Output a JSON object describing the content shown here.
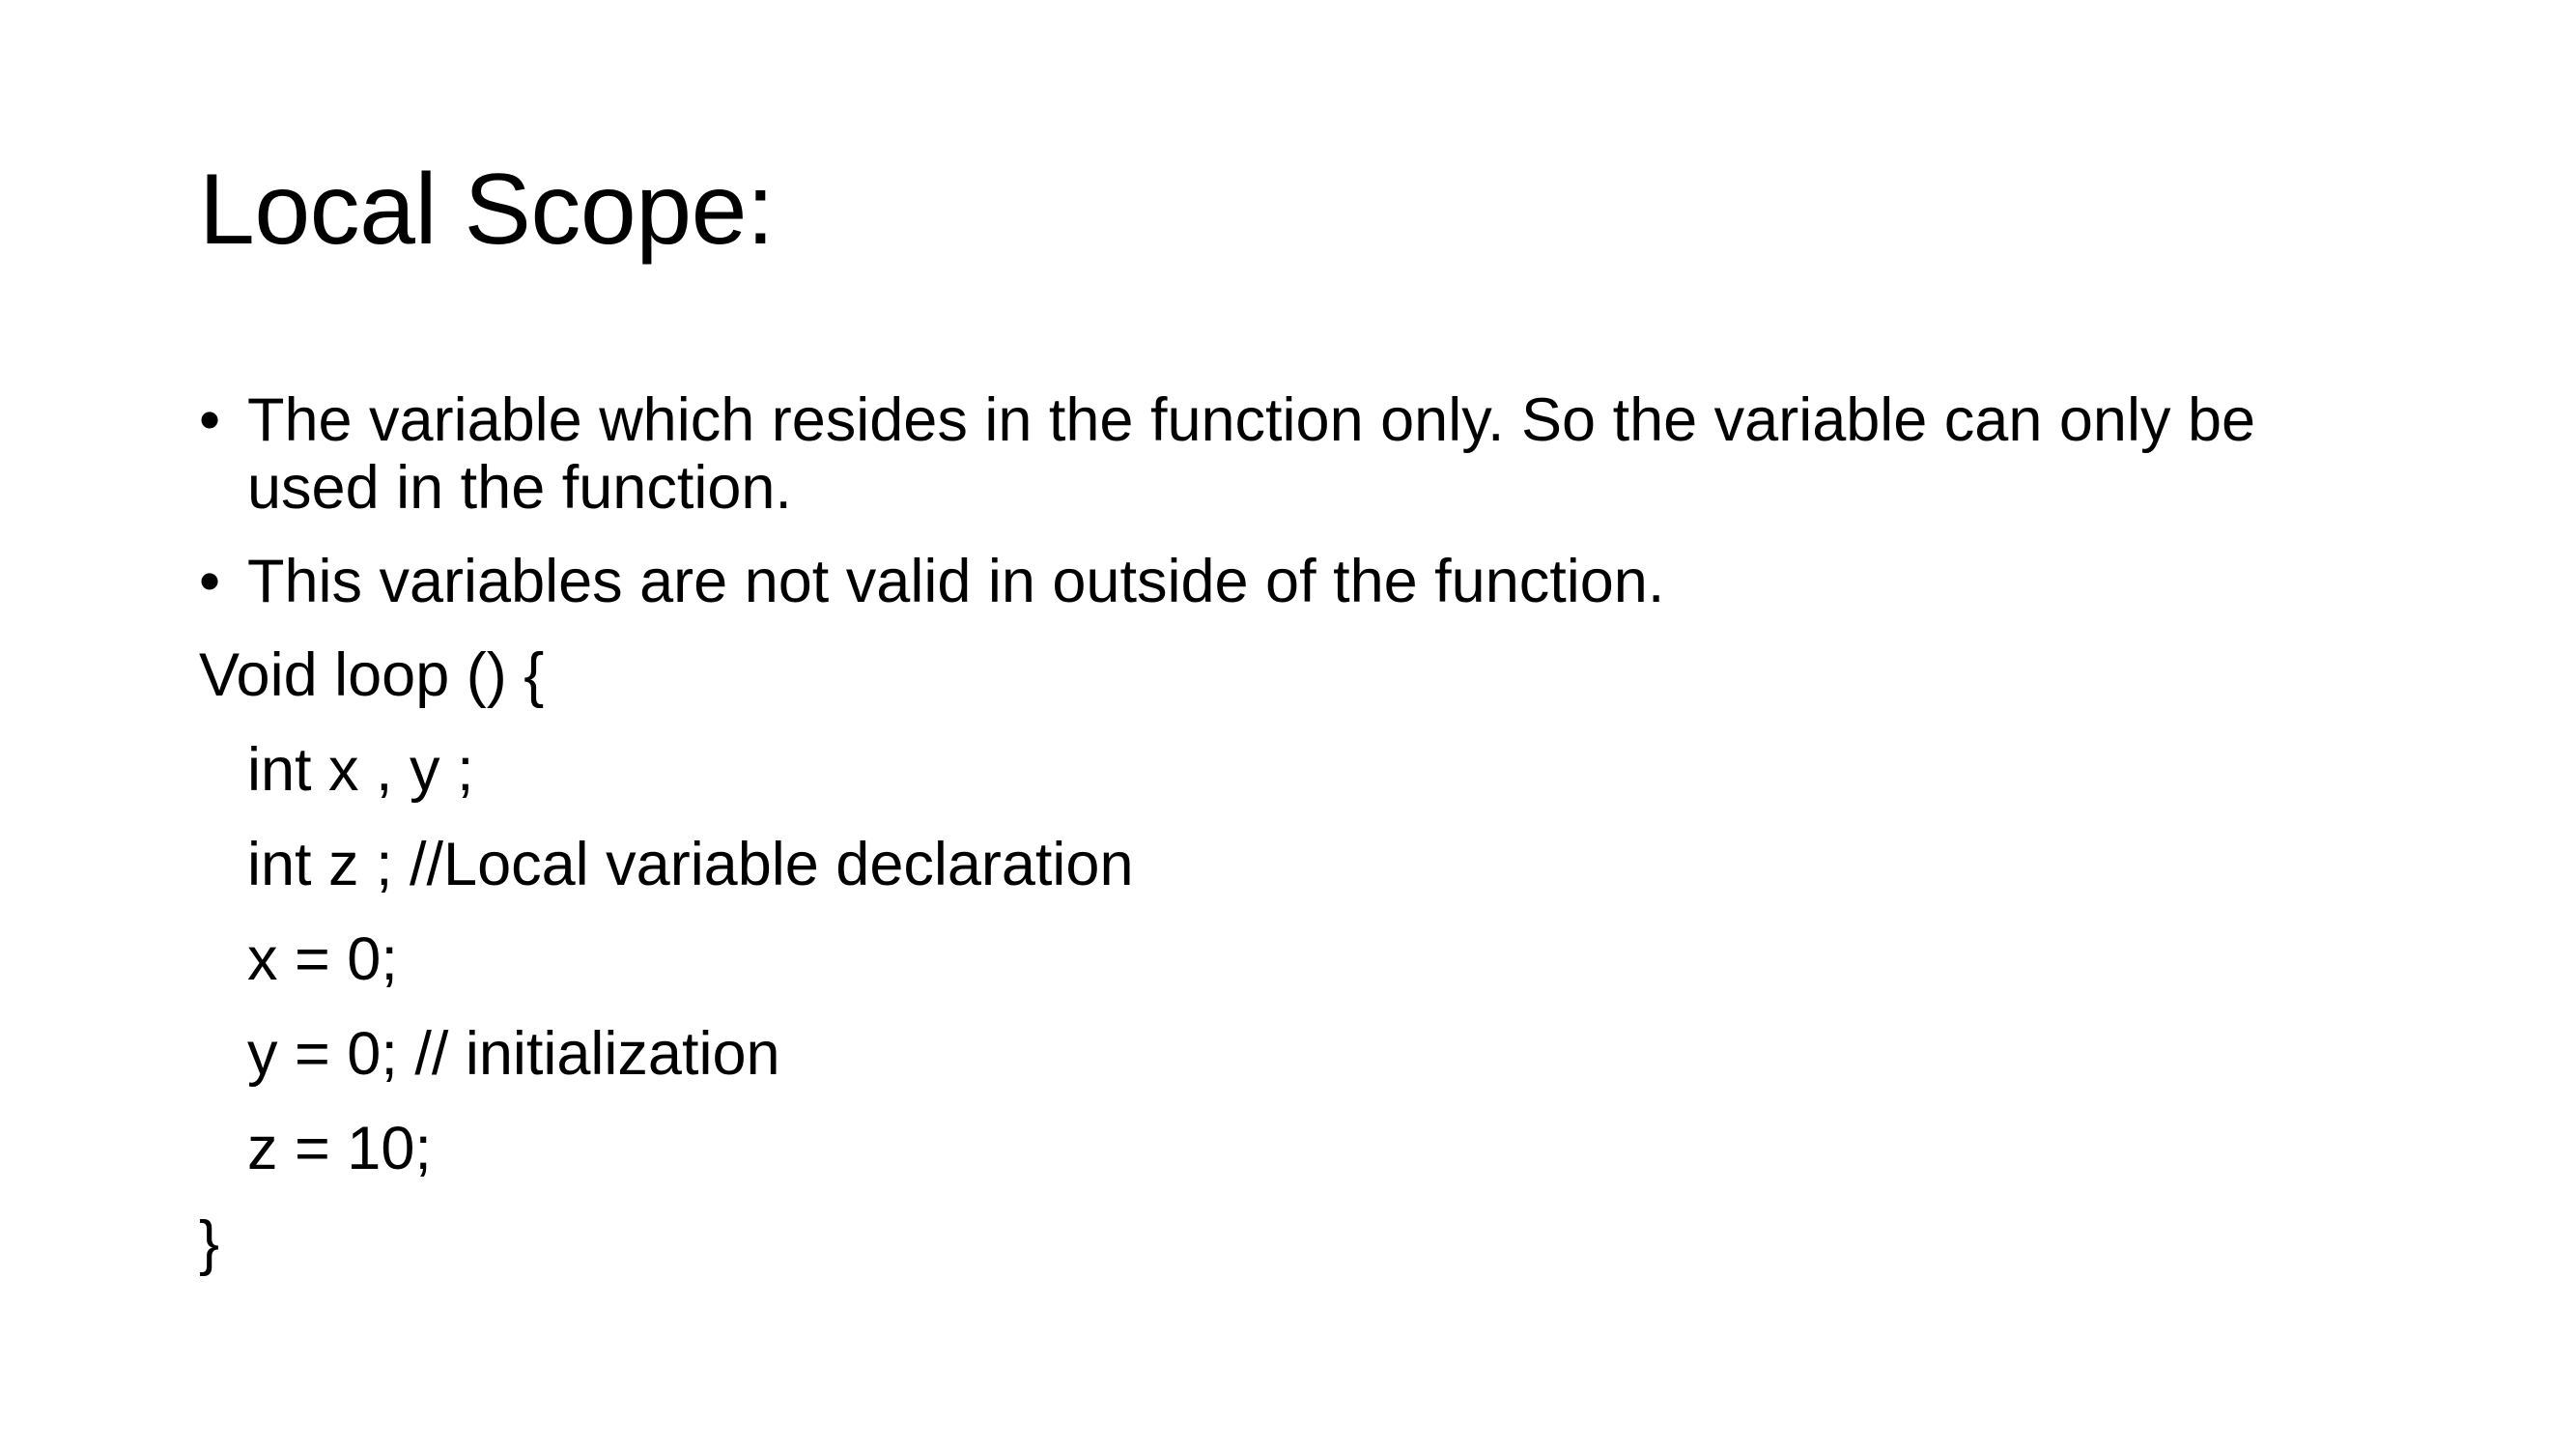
{
  "slide": {
    "title": "Local Scope:",
    "bullets": [
      {
        "marker": "•",
        "text": "The variable which resides in the function only. So the variable can only be used in the function."
      },
      {
        "marker": "•",
        "text": "This variables are not valid in outside of the function."
      }
    ],
    "code": {
      "open": "Void loop () {",
      "body": [
        "int x , y ;",
        "int z ; //Local variable declaration",
        "x = 0;",
        "y = 0; // initialization",
        "z = 10;"
      ],
      "close": "}"
    }
  },
  "colors": {
    "background": "#ffffff",
    "text": "#000000"
  }
}
